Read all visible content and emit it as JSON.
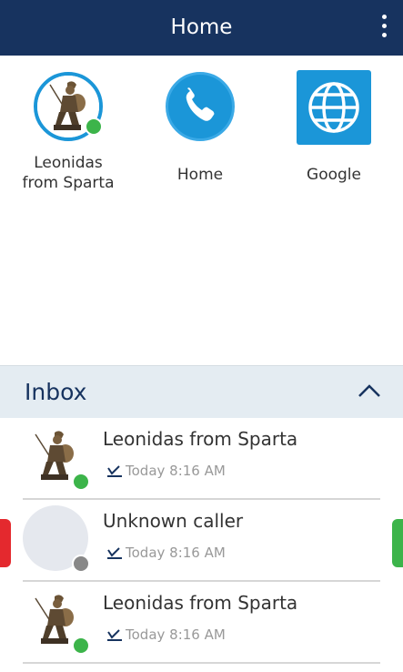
{
  "header": {
    "title": "Home"
  },
  "favorites": [
    {
      "label_line1": "Leonidas",
      "label_line2": "from Sparta",
      "status": "online"
    },
    {
      "label": "Home"
    },
    {
      "label": "Google"
    }
  ],
  "inbox": {
    "title": "Inbox",
    "items": [
      {
        "name": "Leonidas from Sparta",
        "time": "Today 8:16 AM",
        "status": "online"
      },
      {
        "name": "Unknown caller",
        "time": "Today 8:16 AM",
        "status": "offline"
      },
      {
        "name": "Leonidas from Sparta",
        "time": "Today 8:16 AM",
        "status": "online"
      }
    ]
  },
  "colors": {
    "header_bg": "#17335f",
    "accent_blue": "#1b96d8",
    "online": "#3cb44a",
    "offline": "#888888",
    "reject": "#e4292e",
    "accept": "#3cb44a"
  }
}
